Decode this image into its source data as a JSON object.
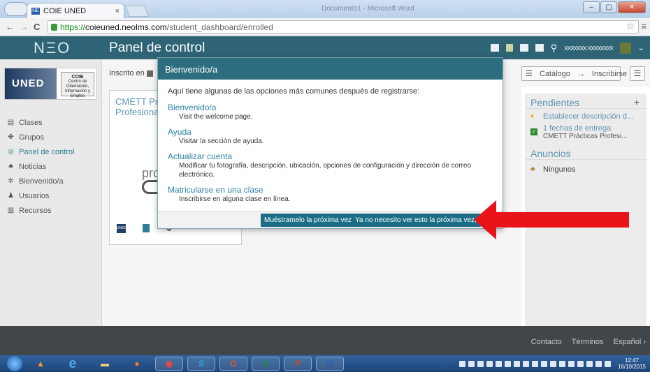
{
  "browser": {
    "tab_title": "COIE UNED",
    "tab_close": "×",
    "window_title": "Documento1 - Microsoft Word",
    "favicon_text": "NE",
    "url_scheme": "https://",
    "url_host": "coieuned.neolms.com",
    "url_path": "/student_dashboard/enrolled",
    "back": "←",
    "forward": "→",
    "reload": "C",
    "star": "☆",
    "menu": "≡",
    "win_min": "–",
    "win_max": "▢",
    "win_close": "✕"
  },
  "header": {
    "logo": "NΞO",
    "page_title": "Panel de control",
    "user_name": "xxxxxxx xxxxxxxx",
    "search_icon": "search-icon",
    "caret": "⌄"
  },
  "sidebar": {
    "org_logo_text": "UNED",
    "org_badge_title": "COIE",
    "org_badge_lines": "Centro de Orientación, Información y Empleo",
    "items": [
      {
        "label": "Clases",
        "icon": "▤"
      },
      {
        "label": "Grupos",
        "icon": "✤"
      },
      {
        "label": "Panel de control",
        "icon": "◎"
      },
      {
        "label": "Noticias",
        "icon": "♣"
      },
      {
        "label": "Bienvenido/a",
        "icon": "✲"
      },
      {
        "label": "Usuarios",
        "icon": "♟"
      },
      {
        "label": "Recursos",
        "icon": "▥"
      }
    ]
  },
  "main": {
    "enrolled_label": "Inscrito en",
    "course_title": "CMETT Pra\nProfesiona",
    "course_logo_text": "prc"
  },
  "toolbar": {
    "catalog_label": "Catálogo",
    "enroll_label": "Inscribirse",
    "arrow": "→",
    "list_icon": "☰",
    "menu_icon": "☰"
  },
  "pending": {
    "title": "Pendientes",
    "plus": "+",
    "item1_label": "Establecer descripción d...",
    "item2_label": "1 fechas de entrega",
    "item2_sub": "CMETT Prácticas Profesi..."
  },
  "announcements": {
    "title": "Anuncios",
    "item": "Ningunos"
  },
  "modal": {
    "title": "Bienvenido/a",
    "intro": "Aquí tiene algunas de las opciones más comunes después de registrarse:",
    "options": [
      {
        "title": "Bienvenido/a",
        "desc": "Visit the welcome page."
      },
      {
        "title": "Ayuda",
        "desc": "Visitar la sección de ayuda."
      },
      {
        "title": "Actualizar cuenta",
        "desc": "Modificar tu fotografía, descripción, ubicación, opciones de configuración y dirección de correo electrónico."
      },
      {
        "title": "Matricularse en una clase",
        "desc": "Inscribirse en alguna clase en línea."
      }
    ],
    "btn_show_next": "Muéstramelo la próxima vez",
    "btn_dont_show": "Ya no necesito ver esto la próxima vez, ¡gracias!"
  },
  "footer": {
    "contact": "Contacto",
    "terms": "Términos",
    "language": "Español ›"
  },
  "taskbar": {
    "time": "12:47",
    "date": "16/10/2015"
  },
  "colors": {
    "header_bg": "#2f6477",
    "modal_button": "#1b6e86",
    "link_blue": "#2c82a8",
    "arrow_red": "#e8141a"
  }
}
